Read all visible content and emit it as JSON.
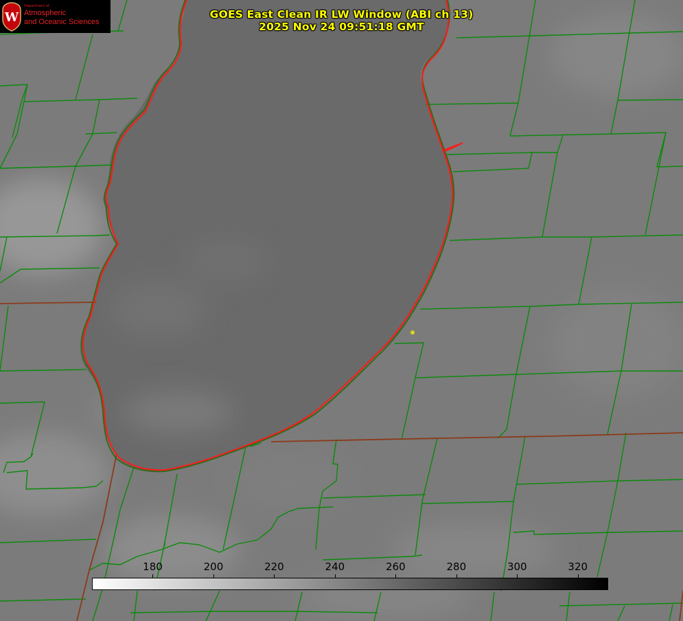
{
  "header": {
    "title_line_1": "GOES East Clean IR LW Window (ABI ch 13)",
    "title_line_2": "2025 Nov 24 09:51:18 GMT"
  },
  "logo": {
    "dept": "Department of",
    "line1": "Atmospheric",
    "line2": "and Oceanic Sciences",
    "seal_letter": "W"
  },
  "colorbar": {
    "unit_note": "",
    "min_value": 160,
    "max_value": 330,
    "gradient_start": "#ffffff",
    "gradient_end": "#000000",
    "ticks": [
      "180",
      "200",
      "220",
      "240",
      "260",
      "280",
      "300",
      "320"
    ]
  },
  "colors": {
    "county_lines": "#0a8a0a",
    "state_lines": "#8b3a1a",
    "lake_shore": "#ff1a1a",
    "title_text": "#ffff00",
    "station_marker": "#d8d81a"
  },
  "features": {
    "lake": "Lake Michigan (southern basin)",
    "station_marker": "yellow-dot"
  }
}
